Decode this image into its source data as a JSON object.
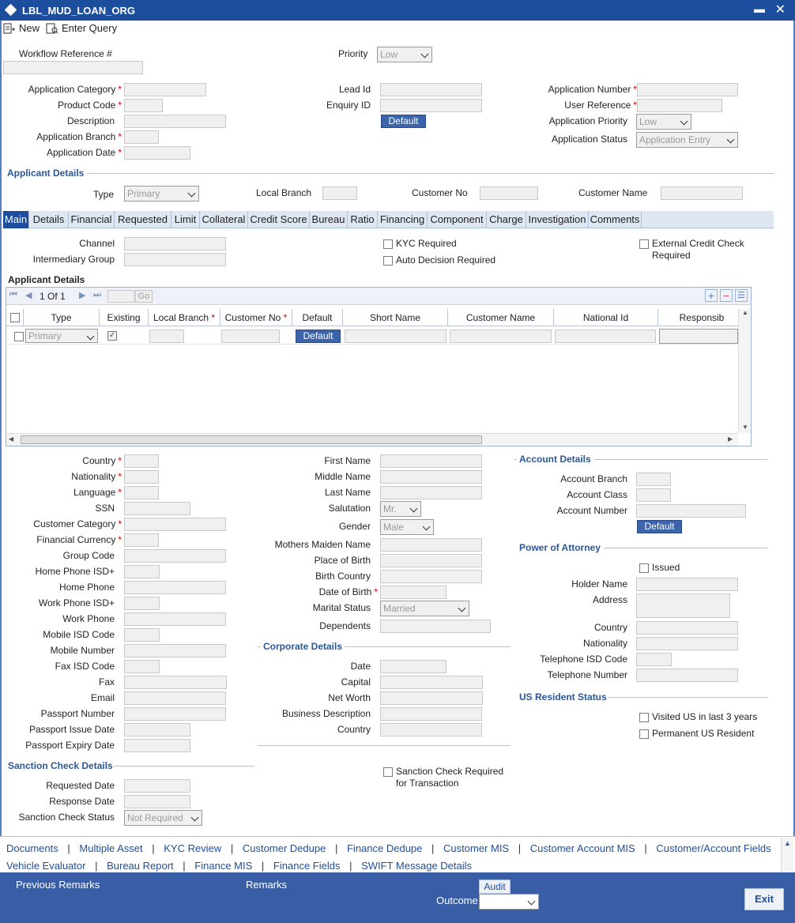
{
  "window": {
    "title": "LBL_MUD_LOAN_ORG"
  },
  "toolbar": {
    "new": "New",
    "enter_query": "Enter Query"
  },
  "top": {
    "workflow_ref": "Workflow Reference #",
    "priority": "Priority",
    "priority_value": "Low"
  },
  "app": {
    "category": "Application Category",
    "product_code": "Product Code",
    "description": "Description",
    "branch": "Application Branch",
    "date": "Application Date",
    "lead_id": "Lead Id",
    "enquiry_id": "Enquiry ID",
    "default_btn": "Default",
    "number": "Application Number",
    "user_ref": "User Reference",
    "app_priority": "Application Priority",
    "app_priority_value": "Low",
    "status": "Application Status",
    "status_value": "Application Entry"
  },
  "applicant": {
    "section": "Applicant Details",
    "type": "Type",
    "type_value": "Primary",
    "local_branch": "Local Branch",
    "customer_no": "Customer No",
    "customer_name": "Customer Name"
  },
  "tabs": [
    "Main",
    "Details",
    "Financial",
    "Requested",
    "Limit",
    "Collateral",
    "Credit Score",
    "Bureau",
    "Ratio",
    "Financing",
    "Component",
    "Charge",
    "Investigation",
    "Comments"
  ],
  "main": {
    "channel": "Channel",
    "intermediary": "Intermediary Group",
    "kyc": "KYC Required",
    "auto": "Auto Decision Required",
    "ext_credit": "External Credit Check",
    "ext_credit2": "Required",
    "grid_title": "Applicant Details",
    "pager": "1 Of 1",
    "go": "Go"
  },
  "grid": {
    "headers": [
      "Type",
      "Existing",
      "Local Branch",
      "Customer No",
      "Default",
      "Short Name",
      "Customer Name",
      "National Id",
      "Responsib"
    ],
    "row": {
      "type": "Primary",
      "default": "Default"
    }
  },
  "left": {
    "country": "Country",
    "nationality": "Nationality",
    "language": "Language",
    "ssn": "SSN",
    "cust_cat": "Customer Category",
    "fin_ccy": "Financial Currency",
    "group_code": "Group Code",
    "home_isd": "Home Phone ISD+",
    "home_phone": "Home Phone",
    "work_isd": "Work Phone ISD+",
    "work_phone": "Work Phone",
    "mobile_isd": "Mobile ISD Code",
    "mobile_no": "Mobile Number",
    "fax_isd": "Fax ISD Code",
    "fax": "Fax",
    "email": "Email",
    "passport_no": "Passport Number",
    "passport_issue": "Passport Issue Date",
    "passport_expiry": "Passport Expiry Date"
  },
  "mid": {
    "first": "First Name",
    "middle": "Middle Name",
    "last": "Last Name",
    "salutation": "Salutation",
    "salutation_value": "Mr.",
    "gender": "Gender",
    "gender_value": "Male",
    "mothers": "Mothers Maiden Name",
    "pob": "Place of Birth",
    "birth_country": "Birth Country",
    "dob": "Date of Birth",
    "marital": "Marital Status",
    "marital_value": "Married",
    "dependents": "Dependents"
  },
  "corporate": {
    "section": "Corporate Details",
    "date": "Date",
    "capital": "Capital",
    "net_worth": "Net Worth",
    "business": "Business Description",
    "country": "Country"
  },
  "account": {
    "section": "Account Details",
    "branch": "Account Branch",
    "class": "Account Class",
    "number": "Account Number",
    "default_btn": "Default"
  },
  "poa": {
    "section": "Power of Attorney",
    "issued": "Issued",
    "holder": "Holder Name",
    "address": "Address",
    "country": "Country",
    "nationality": "Nationality",
    "tel_isd": "Telephone ISD Code",
    "tel_no": "Telephone Number"
  },
  "us": {
    "section": "US Resident Status",
    "visited": "Visited US in last 3 years",
    "permanent": "Permanent US Resident"
  },
  "sanction": {
    "section": "Sanction Check Details",
    "requested": "Requested Date",
    "response": "Response Date",
    "status": "Sanction Check Status",
    "status_value": "Not Required",
    "required": "Sanction Check Required",
    "required2": "for Transaction"
  },
  "links": {
    "row1": [
      "Documents",
      "Multiple Asset",
      "KYC Review",
      "Customer Dedupe",
      "Finance Dedupe",
      "Customer MIS",
      "Customer Account MIS",
      "Customer/Account Fields"
    ],
    "row2": [
      "Vehicle Evaluator",
      "Bureau Report",
      "Finance MIS",
      "Finance Fields",
      "SWIFT Message Details"
    ]
  },
  "footer": {
    "prev_remarks": "Previous Remarks",
    "remarks": "Remarks",
    "audit": "Audit",
    "outcome": "Outcome",
    "exit": "Exit"
  }
}
